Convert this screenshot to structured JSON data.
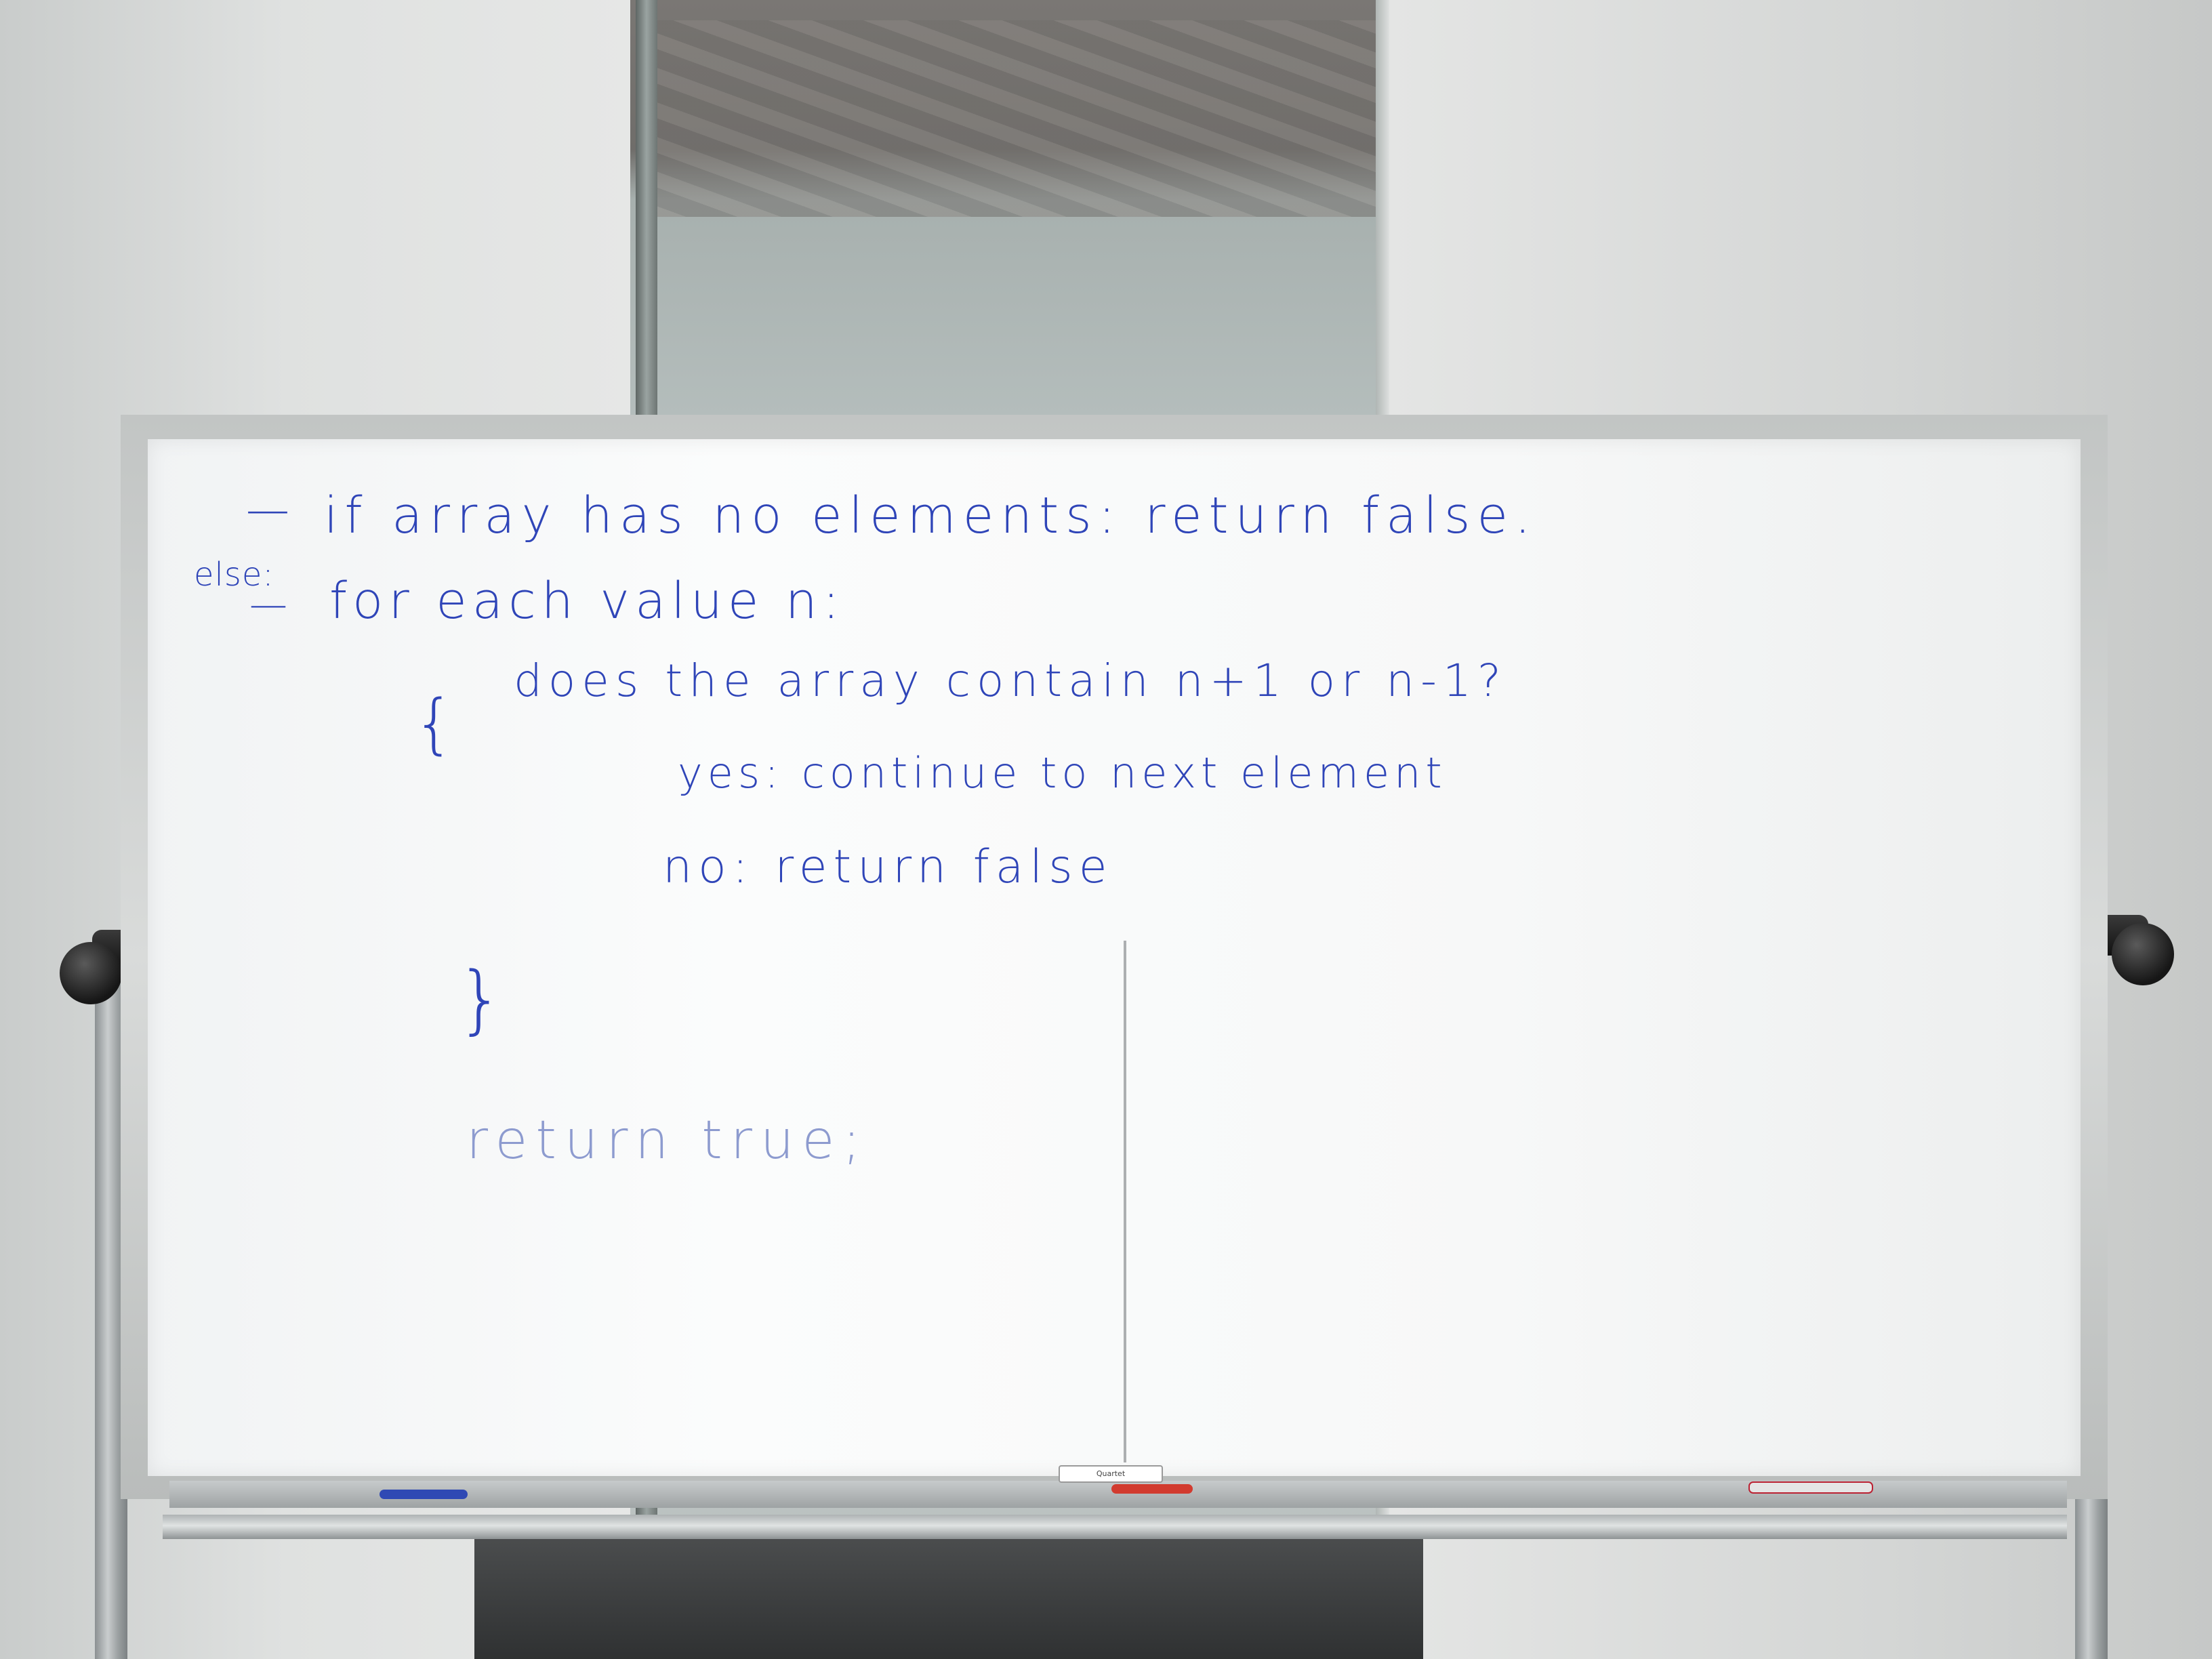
{
  "whiteboard": {
    "line_1": "if array has no elements: return false.",
    "line_else": "else:",
    "line_2": "for each value n:",
    "brace_open": "{",
    "line_3": "does the array contain n+1 or n-1?",
    "line_4": "yes: continue to next element",
    "line_5": "no: return false",
    "brace_close": "}",
    "line_6": "return true;",
    "dash": "—"
  },
  "tray": {
    "maker_label": "Quartet"
  },
  "colors": {
    "ink": "#2f45b8",
    "board": "#f7f8f8"
  }
}
